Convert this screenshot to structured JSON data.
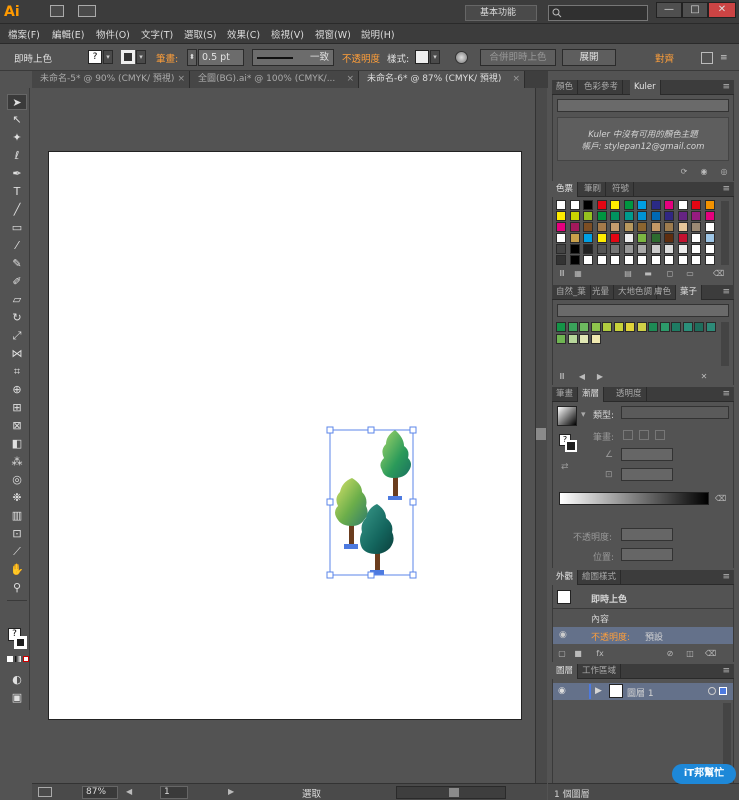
{
  "app": {
    "logo": "Ai",
    "workspace": "基本功能",
    "window_buttons": [
      "—",
      "□",
      "✕"
    ]
  },
  "menubar": {
    "items": [
      "檔案(F)",
      "編輯(E)",
      "物件(O)",
      "文字(T)",
      "選取(S)",
      "效果(C)",
      "檢視(V)",
      "視窗(W)",
      "說明(H)"
    ]
  },
  "controlbar": {
    "selection_label": "即時上色",
    "stroke_label": "筆畫:",
    "stroke_value": "0.5 pt",
    "stroke_style": "一致",
    "opacity_label": "不透明度",
    "style_label": "樣式:",
    "merge_button": "合併即時上色",
    "expand_button": "展開",
    "align_button": "對齊"
  },
  "tabs": [
    {
      "label": "未命名-5* @ 90% (CMYK/ 預視)"
    },
    {
      "label": "全圖(BG).ai* @ 100% (CMYK/..."
    },
    {
      "label": "未命名-6* @ 87% (CMYK/ 預視)"
    }
  ],
  "statusbar": {
    "zoom": "87%",
    "page": "1",
    "tool_status": "選取"
  },
  "panels": {
    "color_tabs": [
      "顏色",
      "色彩參考",
      "Kuler"
    ],
    "kuler_message_line1": "Kuler 中沒有可用的顏色主題",
    "kuler_message_line2": "帳戶: stylepan12@gmail.com",
    "swatch_tabs": [
      "色票",
      "筆刷",
      "符號"
    ],
    "library_tabs": [
      "自然_葉",
      "光暈",
      "大地色調",
      "膚色",
      "葉子"
    ],
    "gradient_tabs": [
      "筆畫",
      "漸層",
      "透明度"
    ],
    "gradient_type_label": "類型:",
    "gradient_stroke_label": "筆畫:",
    "gradient_opacity_label": "不透明度:",
    "gradient_position_label": "位置:",
    "appearance_tabs": [
      "外觀",
      "繪圖樣式"
    ],
    "appearance_title": "即時上色",
    "appearance_contents": "內容",
    "appearance_opacity": "不透明度:",
    "appearance_opacity_value": "預設",
    "layers_tabs": [
      "圖層",
      "工作區域"
    ],
    "layer_name": "圖層 1",
    "layers_count": "1 個圖層",
    "watermark": "iT邦幫忙"
  },
  "colors": {
    "accent": "#ff9a00",
    "selection_blue": "#4d7ae0",
    "layer_highlight": "#64718a"
  }
}
